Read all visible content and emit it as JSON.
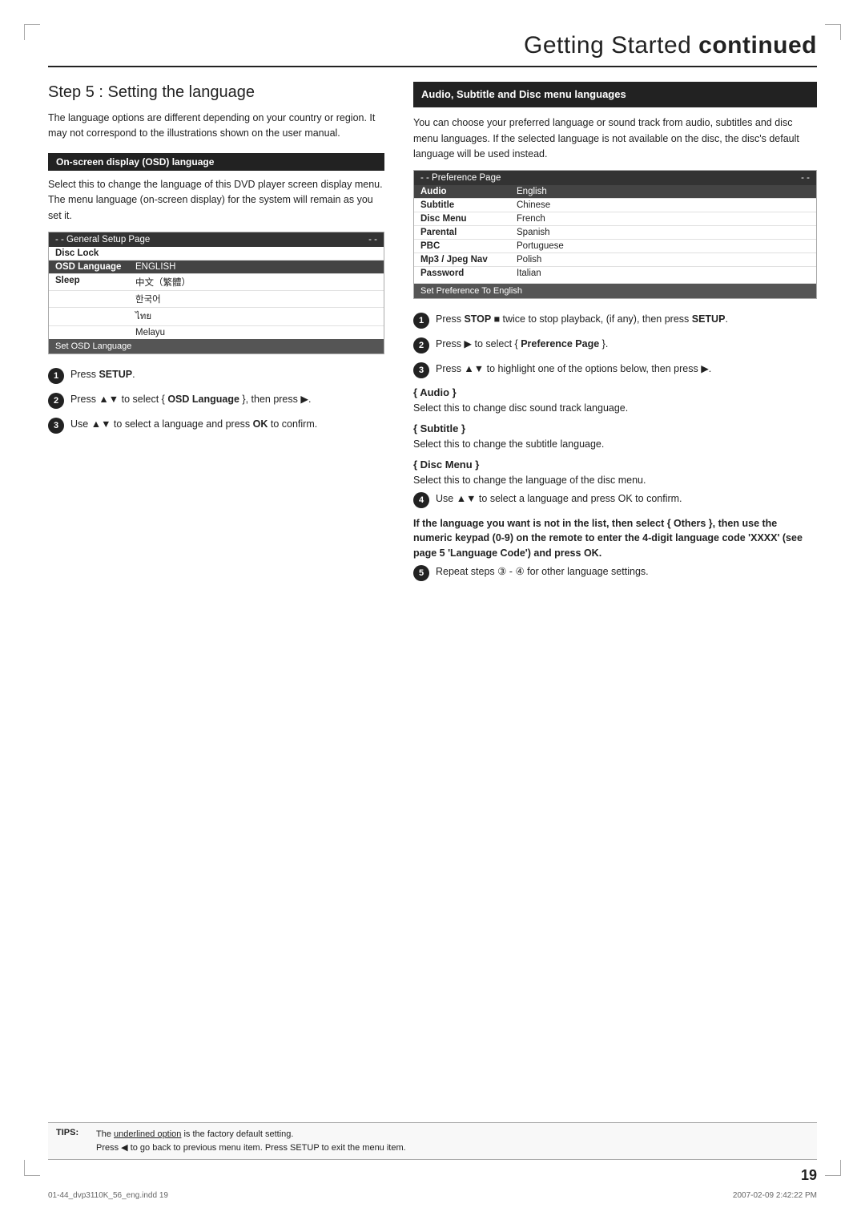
{
  "header": {
    "title_normal": "Getting Started",
    "title_bold": "continued"
  },
  "left_col": {
    "section_title_prefix": "Step 5 :",
    "section_title_main": "Setting the language",
    "intro_text": "The language options are different depending on your country or region. It may not correspond to the illustrations shown on the user manual.",
    "osd_label_bar": "On-screen display (OSD) language",
    "osd_desc": "Select this to change the language of this DVD player screen display menu. The menu language (on-screen display) for the system will remain as you set it.",
    "setup_box": {
      "header_left": "- -  General Setup Page",
      "header_right": "- -",
      "rows": [
        {
          "label": "Disc Lock",
          "value": "",
          "highlighted": false
        },
        {
          "label": "OSD Language",
          "value": "ENGLISH",
          "highlighted": true
        },
        {
          "label": "Sleep",
          "value": "中文（繁體）",
          "highlighted": false
        },
        {
          "label": "",
          "value": "한국어",
          "highlighted": false
        },
        {
          "label": "",
          "value": "ไทย",
          "highlighted": false
        },
        {
          "label": "",
          "value": "Melayu",
          "highlighted": false
        }
      ],
      "footer": "Set OSD Language"
    },
    "steps": [
      {
        "num": "1",
        "text": "Press SETUP."
      },
      {
        "num": "2",
        "text": "Press ▲▼ to select { OSD Language }, then press ▶."
      },
      {
        "num": "3",
        "text": "Use ▲▼ to select a language and press OK to confirm."
      }
    ]
  },
  "right_col": {
    "header": "Audio, Subtitle and Disc menu languages",
    "intro_text": "You can choose your preferred language or sound track from audio, subtitles and disc menu languages. If the selected language is not available on the disc, the disc's default language will be used instead.",
    "pref_box": {
      "header_left": "- -  Preference Page",
      "header_right": "- -",
      "rows": [
        {
          "label": "Audio",
          "value": "English",
          "highlighted": true
        },
        {
          "label": "Subtitle",
          "value": "Chinese",
          "highlighted": false
        },
        {
          "label": "Disc Menu",
          "value": "French",
          "highlighted": false
        },
        {
          "label": "Parental",
          "value": "Spanish",
          "highlighted": false
        },
        {
          "label": "PBC",
          "value": "Portuguese",
          "highlighted": false
        },
        {
          "label": "Mp3 / Jpeg Nav",
          "value": "Polish",
          "highlighted": false
        },
        {
          "label": "Password",
          "value": "Italian",
          "highlighted": false
        }
      ],
      "footer": "Set Preference To English",
      "has_scroll": true
    },
    "steps": [
      {
        "num": "1",
        "text": "Press STOP ■ twice to stop playback, (if any), then press SETUP."
      },
      {
        "num": "2",
        "text": "Press ▶ to select { Preference Page }."
      },
      {
        "num": "3",
        "text": "Press ▲▼ to highlight one of the options below, then press ▶."
      }
    ],
    "audio_heading": "{ Audio }",
    "audio_desc": "Select this to change disc sound track language.",
    "subtitle_heading": "{ Subtitle }",
    "subtitle_desc": "Select this to change the subtitle language.",
    "disc_menu_heading": "{ Disc Menu }",
    "disc_menu_desc": "Select this to change the language of the disc menu.",
    "step4_text": "Use ▲▼ to select a language and press OK to confirm.",
    "bold_note": "If the language you want is not in the list, then select { Others }, then use the numeric keypad (0-9) on the remote to enter the 4-digit language code 'XXXX' (see page 5 'Language Code') and press OK.",
    "step5_text": "Repeat steps ③ - ④ for other language settings."
  },
  "tips": {
    "label": "TIPS:",
    "line1": "The underlined option is the factory default setting.",
    "line2": "Press ◀ to go back to previous menu item. Press SETUP to exit the menu item."
  },
  "page_number": "19",
  "footer_left": "01-44_dvp3110K_56_eng.indd  19",
  "footer_right": "2007-02-09  2:42:22 PM"
}
